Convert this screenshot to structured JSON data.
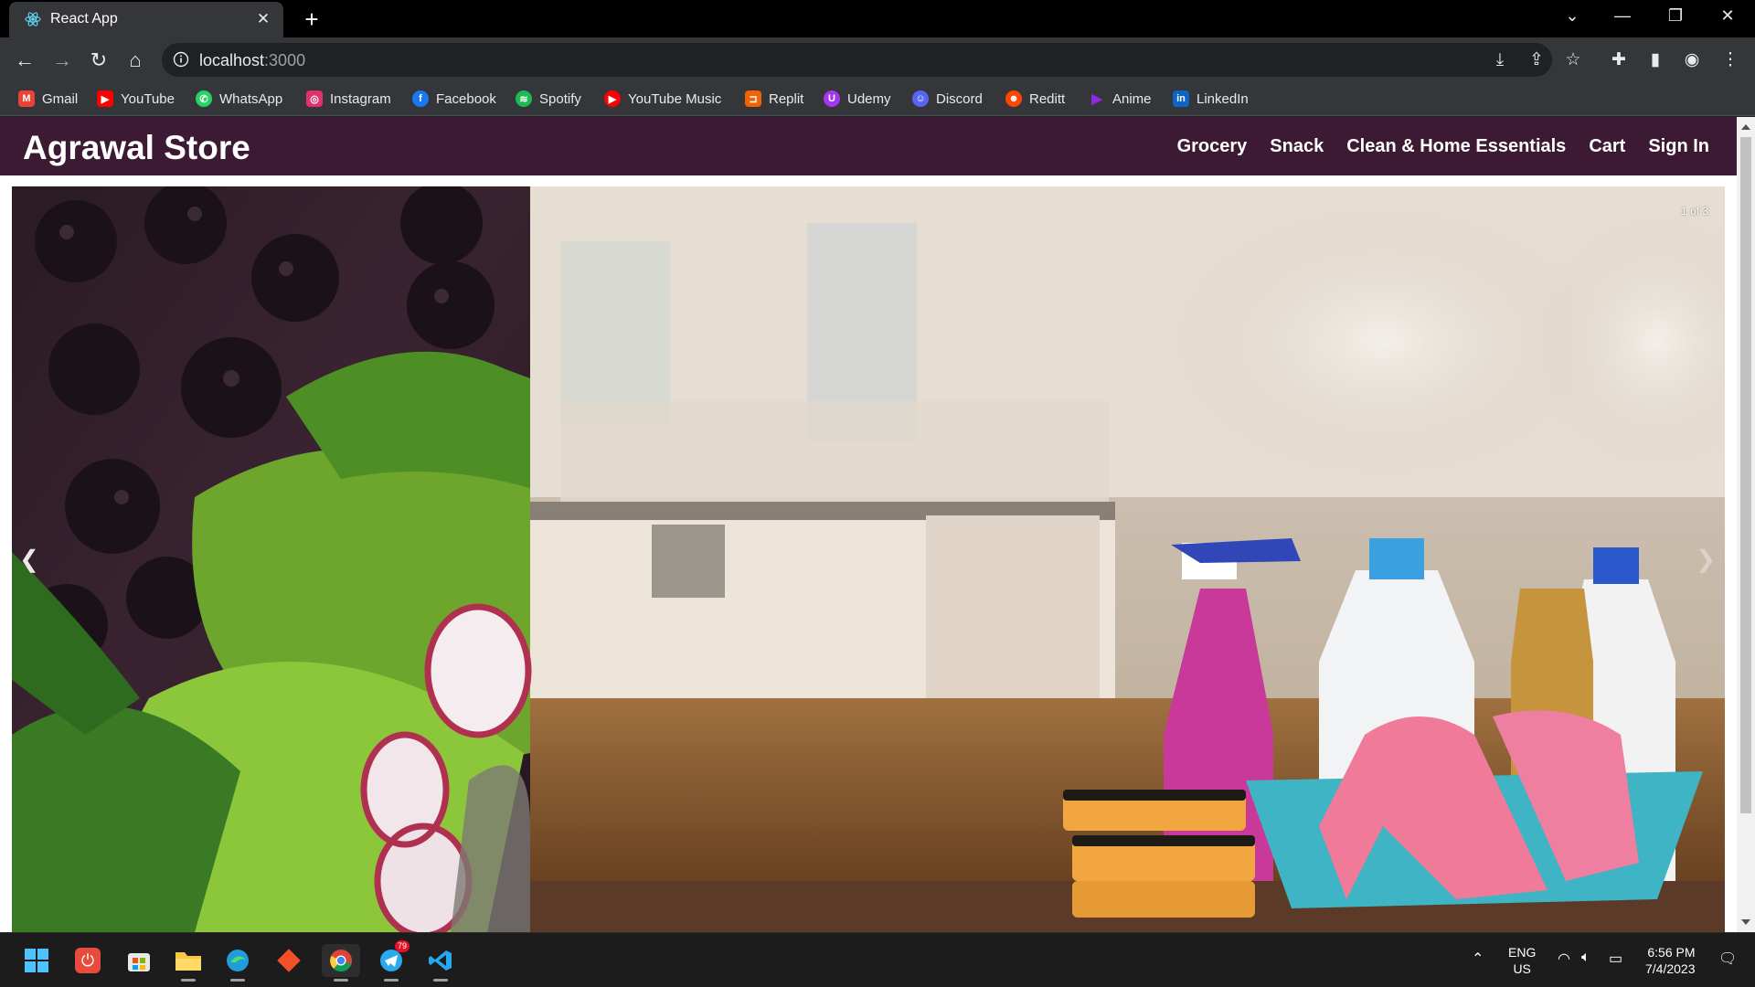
{
  "browser": {
    "tab_title": "React App",
    "url_host": "localhost",
    "url_port": ":3000",
    "bookmarks": [
      {
        "label": "Gmail",
        "icon": "gmail-icon",
        "color": "#ea4335",
        "glyph": "M"
      },
      {
        "label": "YouTube",
        "icon": "youtube-icon",
        "color": "#ff0000",
        "glyph": "▶"
      },
      {
        "label": "WhatsApp",
        "icon": "whatsapp-icon",
        "color": "#25d366",
        "glyph": "✆"
      },
      {
        "label": "Instagram",
        "icon": "instagram-icon",
        "color": "#e1306c",
        "glyph": "◎"
      },
      {
        "label": "Facebook",
        "icon": "facebook-icon",
        "color": "#1877f2",
        "glyph": "f"
      },
      {
        "label": "Spotify",
        "icon": "spotify-icon",
        "color": "#1db954",
        "glyph": "≋"
      },
      {
        "label": "YouTube Music",
        "icon": "youtube-music-icon",
        "color": "#ff0000",
        "glyph": "▶"
      },
      {
        "label": "Replit",
        "icon": "replit-icon",
        "color": "#f26207",
        "glyph": "⊐"
      },
      {
        "label": "Udemy",
        "icon": "udemy-icon",
        "color": "#a435f0",
        "glyph": "U"
      },
      {
        "label": "Discord",
        "icon": "discord-icon",
        "color": "#5865f2",
        "glyph": "☺"
      },
      {
        "label": "Reditt",
        "icon": "reddit-icon",
        "color": "#ff4500",
        "glyph": "☻"
      },
      {
        "label": "Anime",
        "icon": "anime-icon",
        "color": "#8a2be2",
        "glyph": "▶"
      },
      {
        "label": "LinkedIn",
        "icon": "linkedin-icon",
        "color": "#0a66c2",
        "glyph": "in"
      }
    ]
  },
  "site": {
    "brand": "Agrawal Store",
    "nav": [
      "Grocery",
      "Snack",
      "Clean & Home Essentials",
      "Cart",
      "Sign In"
    ],
    "carousel": {
      "counter": "1 of 3",
      "prev_arrow": "❮",
      "next_arrow": "❯"
    }
  },
  "taskbar": {
    "lang_line1": "ENG",
    "lang_line2": "US",
    "time": "6:56 PM",
    "date": "7/4/2023",
    "telegram_badge": "79"
  },
  "colors": {
    "navbar": "#3d1a33",
    "chrome_dark": "#35363a"
  }
}
